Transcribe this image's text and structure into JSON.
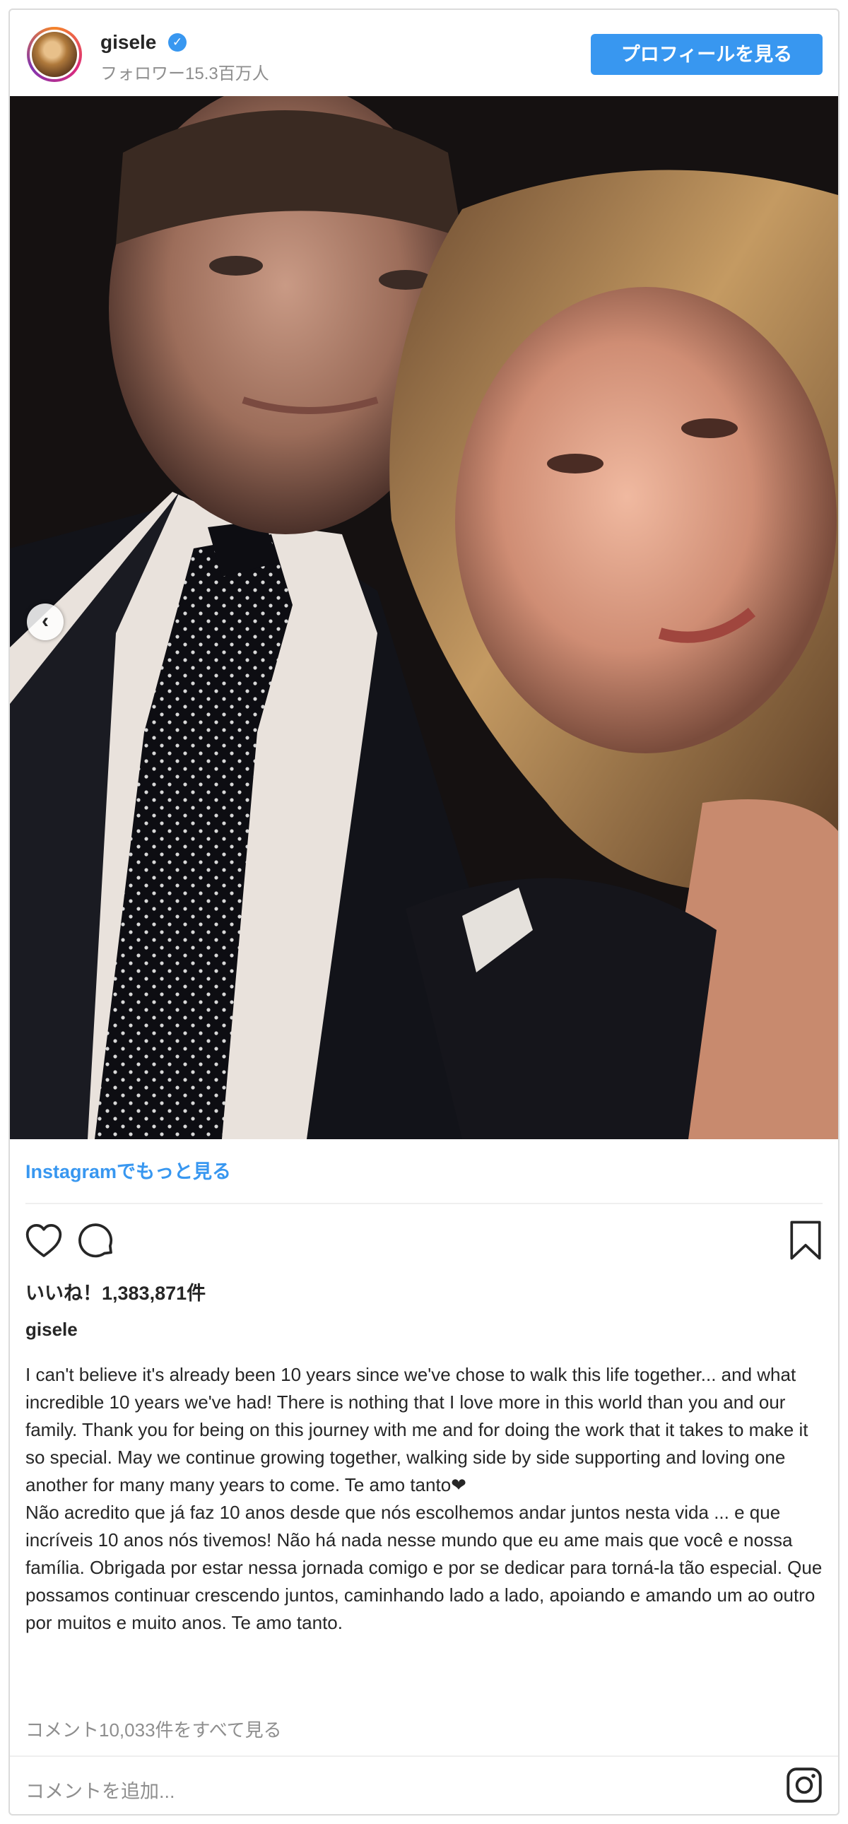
{
  "header": {
    "username": "gisele",
    "followers": "フォロワー15.3百万人",
    "profile_button": "プロフィールを見る"
  },
  "post": {
    "view_more_link": "Instagramでもっと見る",
    "likes": "いいね！1,383,871件",
    "caption_user": "gisele",
    "caption": "I can't believe it's already been 10 years since we've chose to walk this life together... and what incredible 10 years we've had! There is nothing that I love more in this world than you and our family. Thank you for being on this journey with me and for doing the work that it takes to make it so special. May we continue growing together, walking side by side supporting and loving one another for many many years to come. Te amo tanto❤\nNão acredito que já faz 10 anos desde que nós escolhemos andar juntos nesta vida ... e que incríveis 10 anos nós tivemos! Não há nada nesse mundo que eu ame mais que você e nossa família. Obrigada por estar nessa jornada comigo e por se dedicar para torná-la tão especial. Que possamos continuar crescendo juntos, caminhando lado a lado, apoiando e amando um ao outro por muitos e muito anos. Te amo tanto.",
    "view_comments": "コメント10,033件をすべて見る",
    "comment_placeholder": "コメントを追加..."
  },
  "icons": {
    "verified": "verified-badge-icon",
    "prev": "chevron-left-icon",
    "like": "heart-icon",
    "comment": "comment-bubble-icon",
    "save": "bookmark-icon",
    "instagram": "instagram-logo-icon"
  },
  "colors": {
    "accent": "#3897f0",
    "muted": "#8e8e8e",
    "text": "#262626"
  }
}
